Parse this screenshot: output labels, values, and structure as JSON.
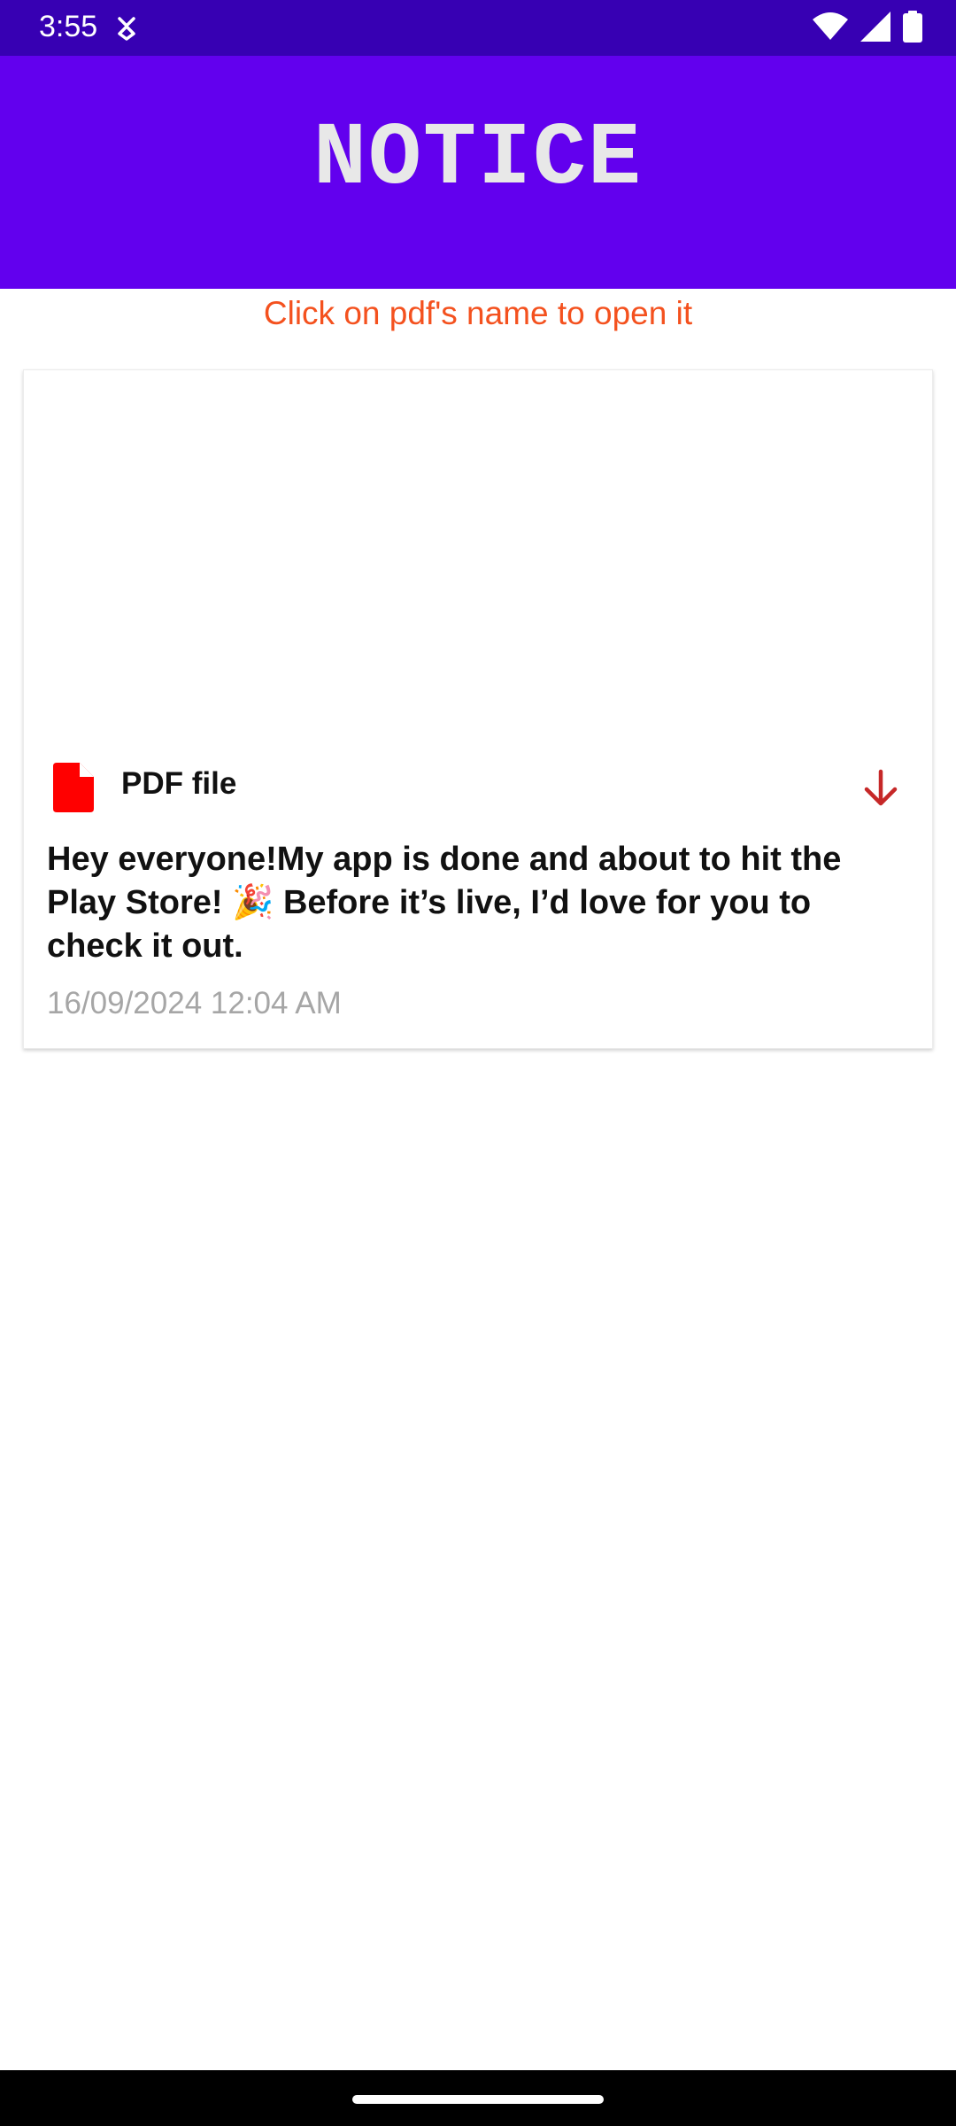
{
  "status_bar": {
    "time": "3:55",
    "background_color": "#3700b3",
    "icons": [
      "download-notification-icon",
      "wifi-icon",
      "cellular-signal-icon",
      "battery-icon"
    ]
  },
  "app_bar": {
    "title": "NOTICE",
    "background_color": "#6200ee"
  },
  "hint": {
    "text": "Click on pdf's name to open it",
    "color": "#f4511e"
  },
  "notices": [
    {
      "file_icon": "pdf-file-icon",
      "file_icon_color": "#ff0000",
      "file_name": "PDF file",
      "download_icon": "arrow-down-icon",
      "download_icon_color": "#c62828",
      "message": "Hey everyone!My app is done and about to hit the Play Store! 🎉 Before it’s live, I’d love for you to check it out.",
      "timestamp": "16/09/2024 12:04 AM"
    }
  ]
}
